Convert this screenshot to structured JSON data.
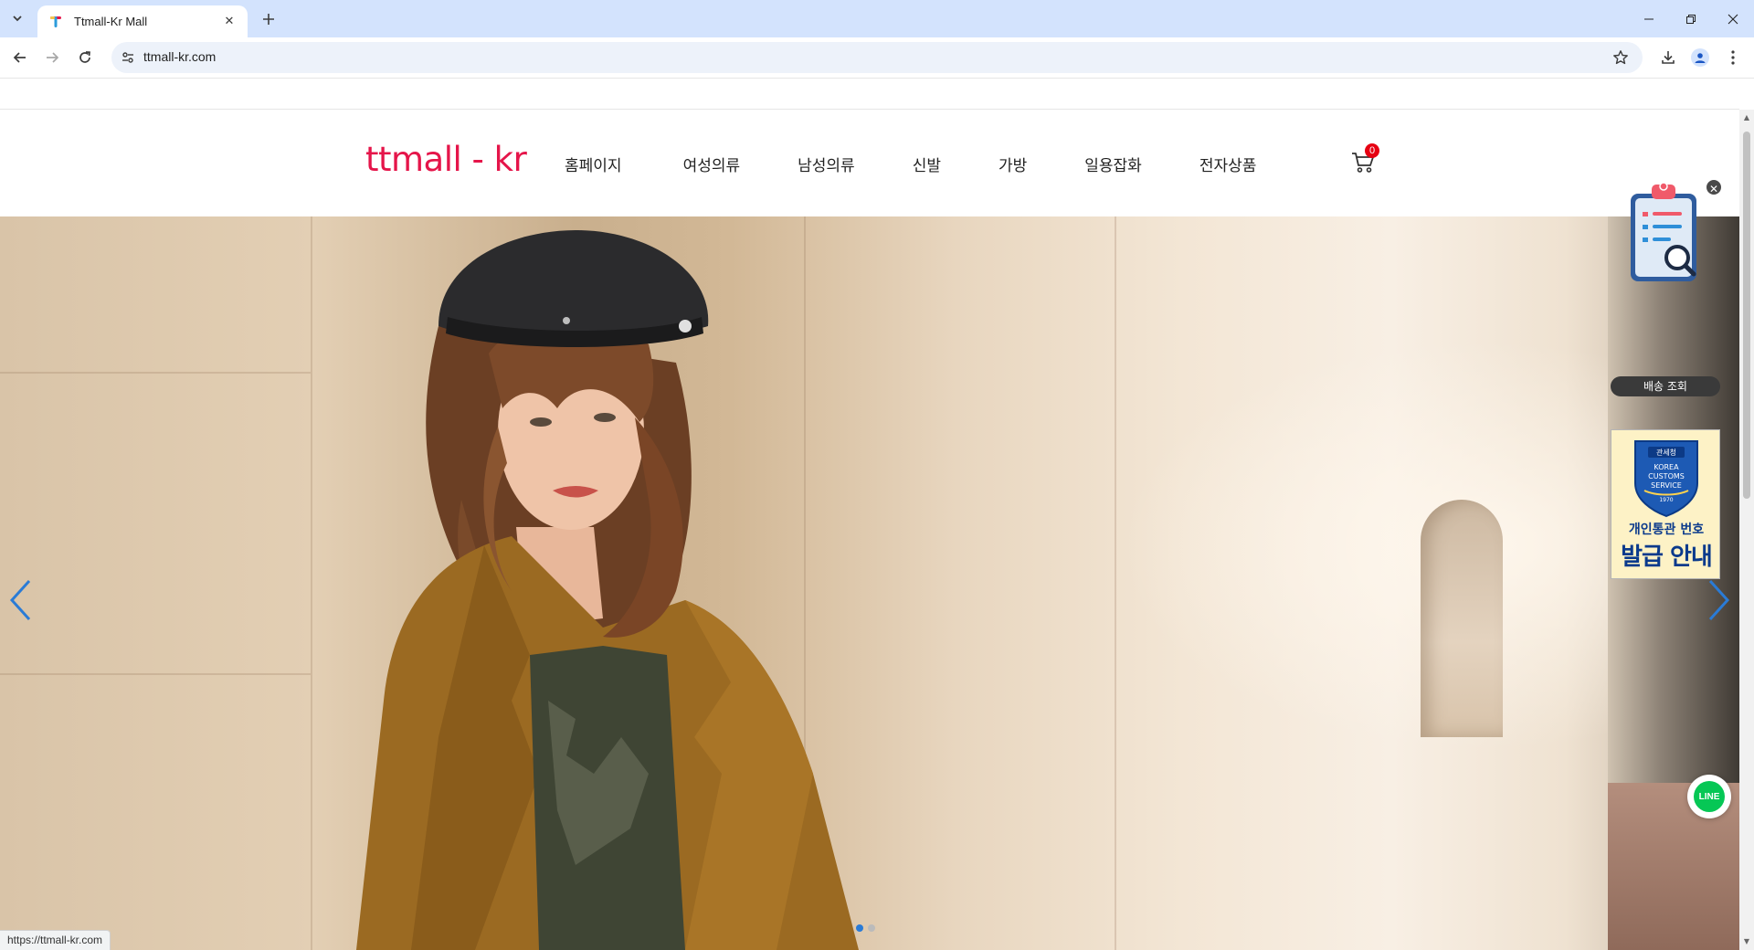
{
  "browser": {
    "tab_title": "Ttmall-Kr Mall",
    "url": "ttmall-kr.com",
    "status_url": "https://ttmall-kr.com"
  },
  "site": {
    "logo": "ttmall - kr",
    "nav": [
      "홈페이지",
      "여성의류",
      "남성의류",
      "신발",
      "가방",
      "일용잡화",
      "전자상품"
    ],
    "cart_count": "0",
    "brand_color": "#e5154a"
  },
  "hero": {
    "slide_count": 2,
    "active_slide": 1
  },
  "floating": {
    "tracking_label": "배송 조회",
    "customs_badge_top": "관세청",
    "customs_badge_lines": [
      "KOREA",
      "CUSTOMS",
      "SERVICE"
    ],
    "customs_badge_year": "1970",
    "customs_line1": "개인통관 번호",
    "customs_line2": "발급 안내",
    "line_label": "LINE"
  }
}
